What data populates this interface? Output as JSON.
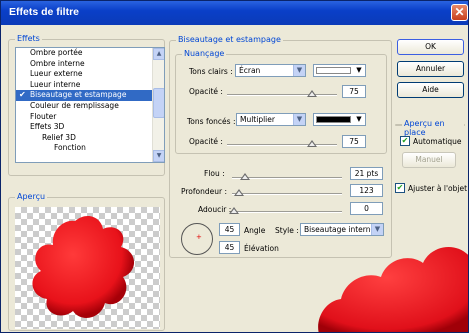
{
  "window": {
    "title": "Effets de filtre",
    "close_glyph": "✕"
  },
  "effects": {
    "label": "Effets",
    "items": [
      {
        "label": "Ombre portée",
        "indent": 0,
        "checked": false,
        "selected": false
      },
      {
        "label": "Ombre interne",
        "indent": 0,
        "checked": false,
        "selected": false
      },
      {
        "label": "Lueur externe",
        "indent": 0,
        "checked": false,
        "selected": false
      },
      {
        "label": "Lueur interne",
        "indent": 0,
        "checked": false,
        "selected": false
      },
      {
        "label": "Biseautage et estampage",
        "indent": 0,
        "checked": true,
        "selected": true
      },
      {
        "label": "Couleur de remplissage",
        "indent": 0,
        "checked": false,
        "selected": false
      },
      {
        "label": "Flouter",
        "indent": 0,
        "checked": false,
        "selected": false
      },
      {
        "label": "Effets 3D",
        "indent": 0,
        "checked": false,
        "selected": false
      },
      {
        "label": "Relief 3D",
        "indent": 1,
        "checked": false,
        "selected": false
      },
      {
        "label": "Fonction",
        "indent": 2,
        "checked": false,
        "selected": false
      }
    ],
    "check_glyph": "✔"
  },
  "preview": {
    "label": "Aperçu",
    "shape_color": "#ee1c24"
  },
  "bevel": {
    "label": "Biseautage et estampage",
    "nuancage_label": "Nuançage",
    "highlights_label": "Tons clairs :",
    "highlights_mode": "Écran",
    "highlights_color": "#ffffff",
    "opacity1_label": "Opacité :",
    "opacity1_value": "75",
    "shadows_label": "Tons foncés :",
    "shadows_mode": "Multiplier",
    "shadows_color": "#000000",
    "opacity2_label": "Opacité :",
    "opacity2_value": "75",
    "blur_label": "Flou :",
    "blur_value": "21 pts",
    "depth_label": "Profondeur :",
    "depth_value": "123",
    "soften_label": "Adoucir :",
    "soften_value": "0",
    "angle_value": "45",
    "angle_label": "Angle",
    "elevation_value": "45",
    "elevation_label": "Élévation",
    "style_label": "Style :",
    "style_value": "Biseautage interne"
  },
  "buttons": {
    "ok": "OK",
    "cancel": "Annuler",
    "help": "Aide"
  },
  "live_preview": {
    "label": "Aperçu en place",
    "automatic_label": "Automatique",
    "automatic_checked": true,
    "manual_label": "Manuel"
  },
  "fit_object": {
    "label": "Ajuster à l'objet",
    "checked": true
  },
  "icons": {
    "arrow_down": "▼",
    "arrow_up": "▲",
    "dial_dot": "+"
  }
}
